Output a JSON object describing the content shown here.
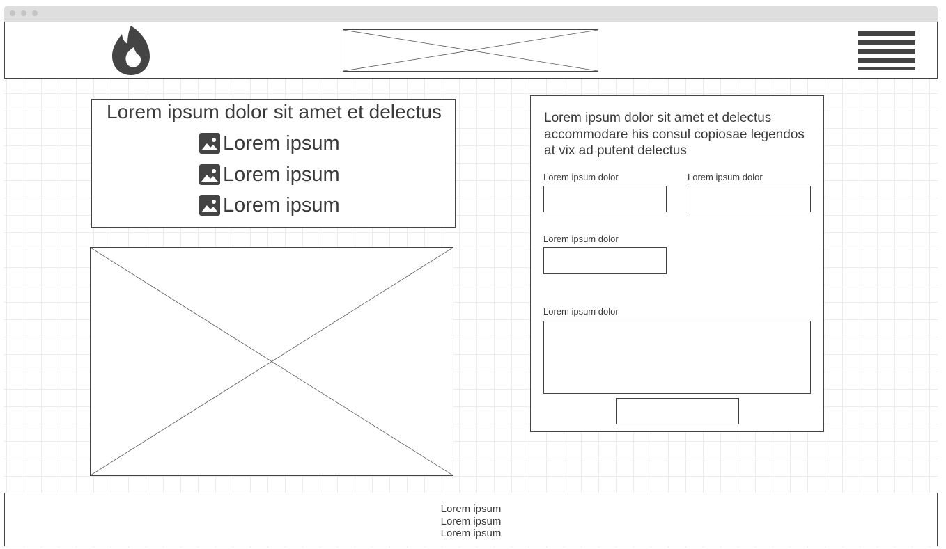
{
  "header": {
    "logo_icon": "flame-logo-icon",
    "banner_image": "image-placeholder",
    "menu_icon": "hamburger-menu-icon"
  },
  "list_panel": {
    "title": "Lorem ipsum dolor sit amet et delectus",
    "items": [
      {
        "icon": "image-icon",
        "label": "Lorem ipsum"
      },
      {
        "icon": "image-icon",
        "label": "Lorem ipsum"
      },
      {
        "icon": "image-icon",
        "label": "Lorem ipsum"
      }
    ]
  },
  "main_image": "image-placeholder",
  "form": {
    "heading": "Lorem ipsum dolor sit amet et delectus accommodare his consul copiosae legendos at vix ad putent delectus",
    "fields": [
      {
        "label": "Lorem ipsum dolor",
        "value": ""
      },
      {
        "label": "Lorem ipsum dolor",
        "value": ""
      },
      {
        "label": "Lorem ipsum dolor",
        "value": ""
      },
      {
        "label": "Lorem ipsum dolor",
        "value": ""
      }
    ],
    "submit_label": ""
  },
  "footer": {
    "lines": [
      "Lorem ipsum",
      "Lorem ipsum",
      "Lorem ipsum"
    ]
  },
  "colors": {
    "stroke": "#444444",
    "text": "#3a3a3a",
    "grid": "#ececec",
    "window_bar": "#dedede"
  }
}
